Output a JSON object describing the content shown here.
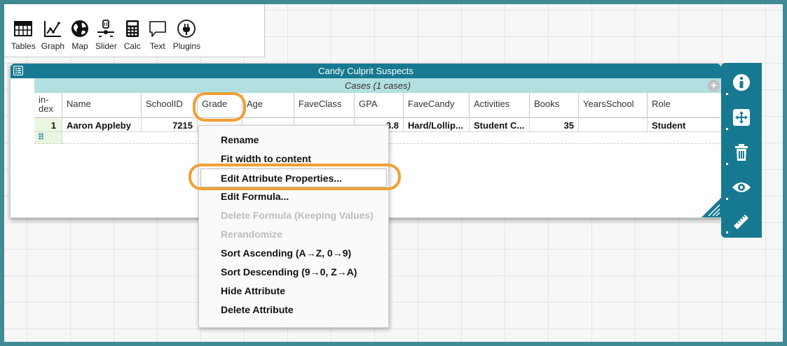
{
  "toolbar": {
    "items": [
      {
        "label": "Tables",
        "icon": "tables-icon"
      },
      {
        "label": "Graph",
        "icon": "graph-icon"
      },
      {
        "label": "Map",
        "icon": "map-icon"
      },
      {
        "label": "Slider",
        "icon": "slider-icon"
      },
      {
        "label": "Calc",
        "icon": "calc-icon"
      },
      {
        "label": "Text",
        "icon": "text-icon"
      },
      {
        "label": "Plugins",
        "icon": "plugins-icon"
      }
    ]
  },
  "table": {
    "title": "Candy Culprit Suspects",
    "cases_label": "Cases (1 cases)",
    "add_symbol": "+",
    "columns": [
      "in-\ndex",
      "Name",
      "SchoolID",
      "Grade",
      "Age",
      "FaveClass",
      "GPA",
      "FaveCandy",
      "Activities",
      "Books",
      "YearsSchool",
      "Role"
    ],
    "rows": [
      {
        "index": "1",
        "Name": "Aaron Appleby",
        "SchoolID": "7215",
        "GPA": "3.8",
        "FaveCandy": "Hard/Lollip...",
        "Activities": "Student C...",
        "Books": "35",
        "Role": "Student"
      }
    ],
    "new_row_icon": "⠿"
  },
  "context_menu": {
    "items": [
      {
        "label": "Rename",
        "enabled": true
      },
      {
        "label": "Fit width to content",
        "enabled": true
      },
      {
        "label": "Edit Attribute Properties...",
        "enabled": true,
        "highlighted": true
      },
      {
        "label": "Edit Formula...",
        "enabled": true
      },
      {
        "label": "Delete Formula (Keeping Values)",
        "enabled": false
      },
      {
        "label": "Rerandomize",
        "enabled": false
      },
      {
        "label": "Sort Ascending (A→Z, 0→9)",
        "enabled": true
      },
      {
        "label": "Sort Descending (9→0, Z→A)",
        "enabled": true
      },
      {
        "label": "Hide Attribute",
        "enabled": true
      },
      {
        "label": "Delete Attribute",
        "enabled": true
      }
    ]
  },
  "inspector": {
    "buttons": [
      "info-icon",
      "scale-icon",
      "trash-icon",
      "eye-icon",
      "ruler-icon"
    ]
  },
  "colors": {
    "accent": "#177991",
    "cases_bar": "#b2dfe0",
    "highlight": "#f29e35",
    "border": "#3f8a94"
  }
}
